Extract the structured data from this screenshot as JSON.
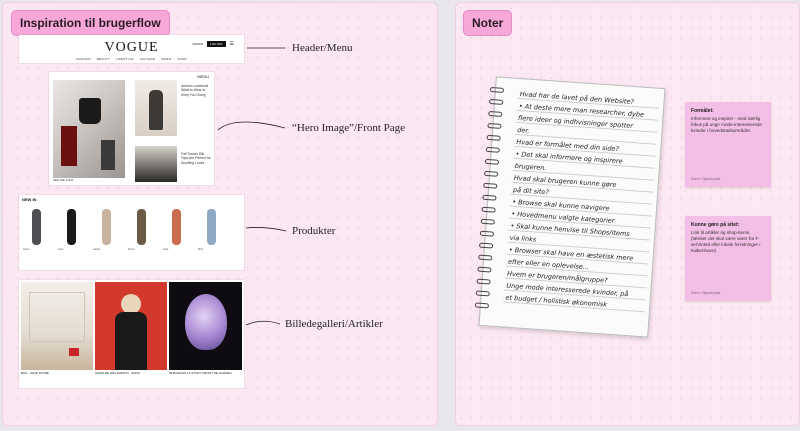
{
  "left_board": {
    "title": "Inspiration til brugerflow",
    "labels": {
      "header": "Header/Menu",
      "hero": "“Hero Image”/Front Page",
      "products": "Produkter",
      "gallery": "Billedegalleri/Artikler"
    },
    "header_frame": {
      "logo": "VOGUE",
      "nav_items": [
        "FASHION",
        "BEAUTY",
        "LIFESTYLE",
        "CULTURE",
        "VIDEO",
        "SHOP"
      ],
      "right_text": "SØGER",
      "button": "LOG IND"
    },
    "hero_frame": {
      "menu": "MENU",
      "side_texts": [
        "Autumn Lookbook What to Wear to Keep You Going",
        "Fall Trends Silk Tops Are Perfect for Anything Looks"
      ],
      "caption": "SEE THE LOOK"
    },
    "products_frame": {
      "title": "NEW IN",
      "captions": [
        "Dress",
        "Coat",
        "Jacket",
        "Dress",
        "Coat",
        "Shirt"
      ]
    },
    "gallery_frame": {
      "captions": [
        "BAG · SAVE STORE",
        "CHRISTIE WILLIAMSON · SHOP",
        "PARAGRAPH & STORY FROM THE GARDEN"
      ]
    }
  },
  "right_board": {
    "title": "Noter",
    "notebook_lines": [
      "Hvad har de lavet på den Website?",
      "• At deste mere man researcher, dybe",
      "  flere ideer og indhvisninger spotter",
      "  der.",
      "Hvad er formålet med din side?",
      "• Det skal informere og inspirere",
      "  brugeren.",
      "Hvad skal brugeren kunne gøre",
      "på dit site?",
      "• Browse skal kunne navigere",
      "  • Hovedmenu valgte kategorier",
      "• Skal kunne henvise til Shops/items",
      "  via links",
      "• Browser skal have en æstetisk mere",
      "  efter eller en oplevelse...",
      "Hvem er brugeren/målgruppe?",
      "Unge mode interesserede kvinder, på",
      "et budget / holistisk økonomisk"
    ],
    "sticky1": {
      "title": "Formålet:",
      "body": "Informere og inspirer - med særlig fokus på unge mode-interesserede kvinder i hovedstadsområdet.",
      "author": "Katrin Skjødepolar"
    },
    "sticky2": {
      "title": "Kunne gøre på sitet:",
      "body": "Link til artikler og shop-items. (tænker det skal være varer fra T-se/Vinted eller lokale forretninger i København)",
      "author": "Katrin Skjødepolar"
    }
  },
  "colors": {
    "board_bg": "#fce8f2",
    "title_tag": "#f7a8d8",
    "sticky": "#f4bfe6"
  }
}
